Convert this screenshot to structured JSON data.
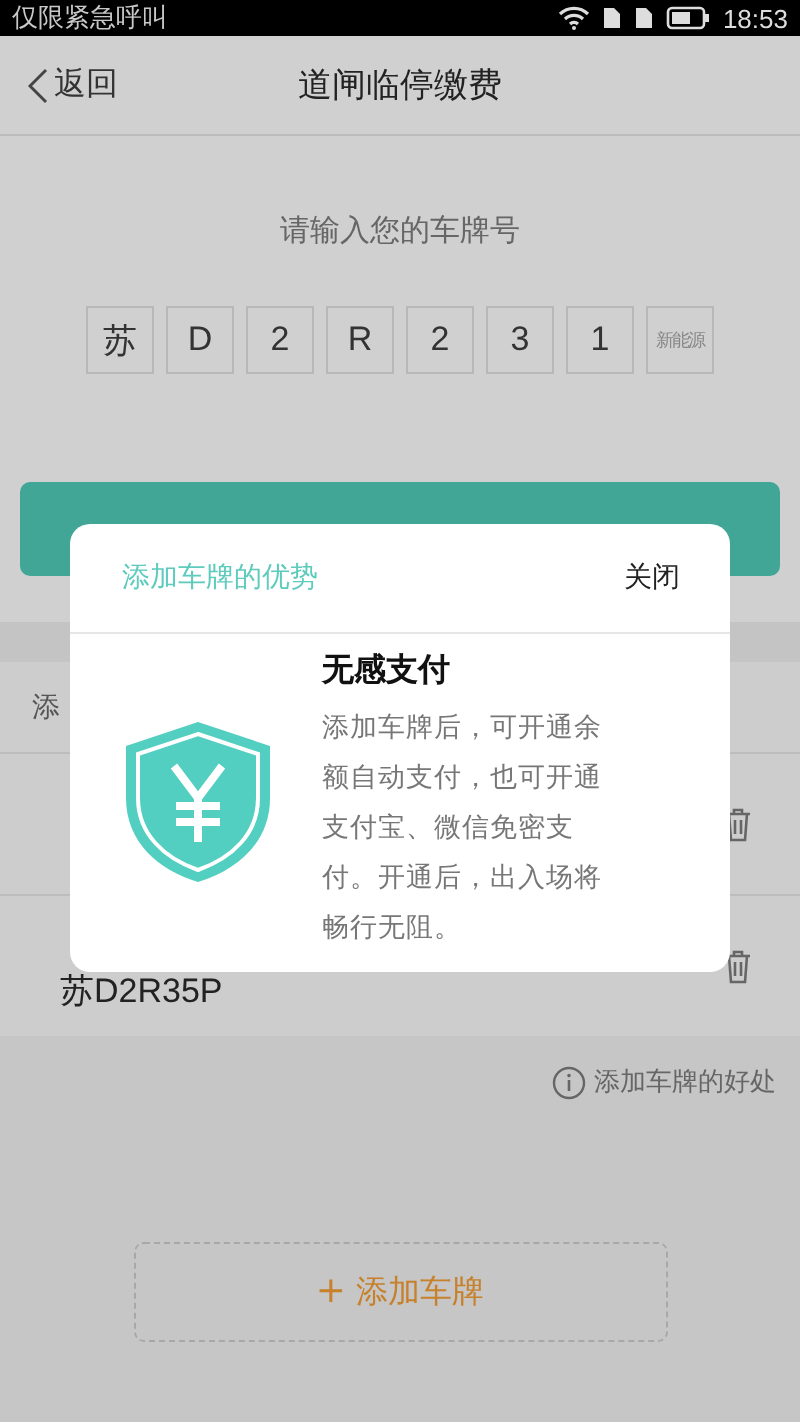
{
  "status_bar": {
    "carrier": "仅限紧急呼叫",
    "time": "18:53"
  },
  "header": {
    "back": "返回",
    "title": "道闸临停缴费"
  },
  "prompt": "请输入您的车牌号",
  "plate_chars": [
    {
      "char": "苏",
      "kind": "char"
    },
    {
      "char": "D",
      "kind": "char"
    },
    {
      "char": "2",
      "kind": "char"
    },
    {
      "char": "R",
      "kind": "char"
    },
    {
      "char": "2",
      "kind": "char"
    },
    {
      "char": "3",
      "kind": "char"
    },
    {
      "char": "1",
      "kind": "char"
    },
    {
      "char": "新能源",
      "kind": "new-energy"
    }
  ],
  "plate_list": {
    "heading": "添",
    "rows": [
      {
        "plate": ""
      },
      {
        "plate": "苏D2R35P"
      }
    ]
  },
  "benefits_link": "添加车牌的好处",
  "add_button": "添加车牌",
  "add_icon": "+",
  "dialog": {
    "title": "添加车牌的优势",
    "close": "关闭",
    "heading": "无感支付",
    "body": "添加车牌后，可开通余额自动支付，也可开通支付宝、微信免密支付。开通后，出入场将畅行无阻。"
  }
}
